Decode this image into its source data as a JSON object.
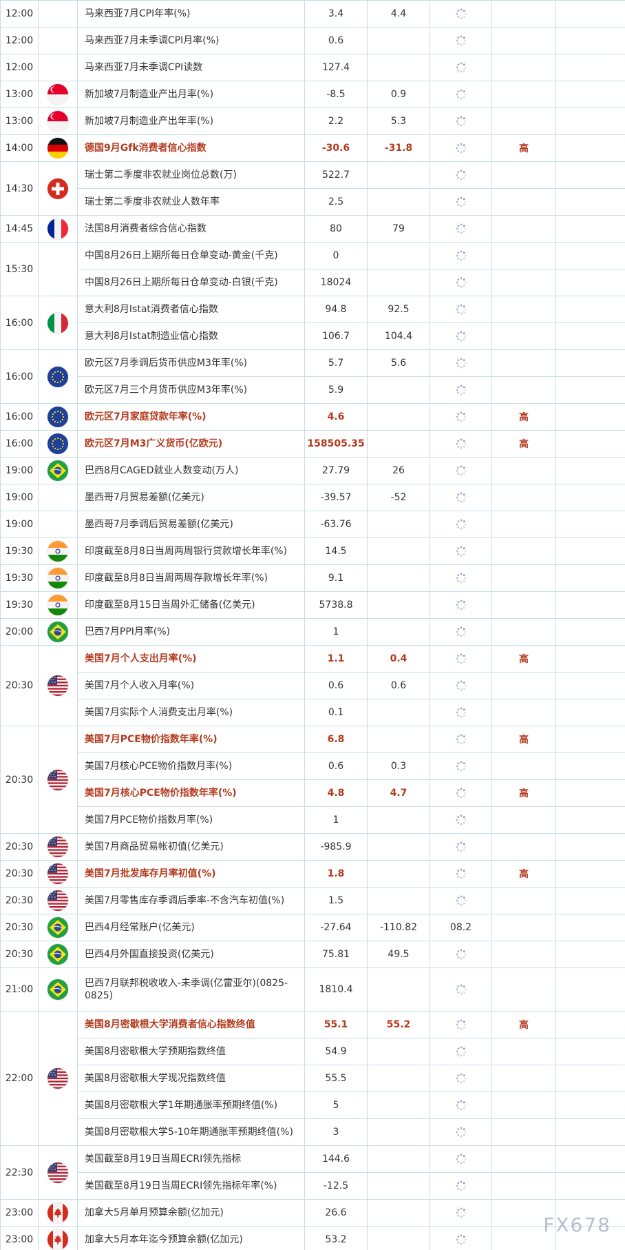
{
  "watermark": "FX678",
  "colors": {
    "border": "#c8dcea",
    "highlight": "#b33a1e",
    "text": "#333333"
  },
  "rows": [
    {
      "time": "12:00",
      "flag": "malaysia",
      "event": "马来西亚7月CPI年率(%)",
      "actual": "3.4",
      "forecast": "4.4",
      "importance": "",
      "hi": false
    },
    {
      "time": "12:00",
      "flag": "malaysia",
      "event": "马来西亚7月未季调CPI月率(%)",
      "actual": "0.6",
      "forecast": "",
      "importance": "",
      "hi": false
    },
    {
      "time": "12:00",
      "flag": "malaysia",
      "event": "马来西亚7月未季调CPI读数",
      "actual": "127.4",
      "forecast": "",
      "importance": "",
      "hi": false
    },
    {
      "time": "13:00",
      "flag": "singapore",
      "event": "新加坡7月制造业产出月率(%)",
      "actual": "-8.5",
      "forecast": "0.9",
      "importance": "",
      "hi": false
    },
    {
      "time": "13:00",
      "flag": "singapore",
      "event": "新加坡7月制造业产出年率(%)",
      "actual": "2.2",
      "forecast": "5.3",
      "importance": "",
      "hi": false
    },
    {
      "time": "14:00",
      "flag": "germany",
      "event": "德国9月Gfk消费者信心指数",
      "actual": "-30.6",
      "forecast": "-31.8",
      "importance": "高",
      "hi": true
    },
    {
      "time": "14:30",
      "flag": "switzerland",
      "event": "瑞士第二季度非农就业岗位总数(万)",
      "actual": "522.7",
      "forecast": "",
      "importance": "",
      "hi": false,
      "span": 2
    },
    {
      "time": "",
      "flag": "",
      "event": "瑞士第二季度非农就业人数年率",
      "actual": "2.5",
      "forecast": "",
      "importance": "",
      "hi": false,
      "cont": true
    },
    {
      "time": "14:45",
      "flag": "france",
      "event": "法国8月消费者综合信心指数",
      "actual": "80",
      "forecast": "79",
      "importance": "",
      "hi": false
    },
    {
      "time": "15:30",
      "flag": "china",
      "event": "中国8月26日上期所每日仓单变动-黄金(千克)",
      "actual": "0",
      "forecast": "",
      "importance": "",
      "hi": false,
      "span": 2
    },
    {
      "time": "",
      "flag": "",
      "event": "中国8月26日上期所每日仓单变动-白银(千克)",
      "actual": "18024",
      "forecast": "",
      "importance": "",
      "hi": false,
      "cont": true
    },
    {
      "time": "16:00",
      "flag": "italy",
      "event": "意大利8月Istat消费者信心指数",
      "actual": "94.8",
      "forecast": "92.5",
      "importance": "",
      "hi": false,
      "span": 2
    },
    {
      "time": "",
      "flag": "",
      "event": "意大利8月Istat制造业信心指数",
      "actual": "106.7",
      "forecast": "104.4",
      "importance": "",
      "hi": false,
      "cont": true
    },
    {
      "time": "16:00",
      "flag": "eu",
      "event": "欧元区7月季调后货币供应M3年率(%)",
      "actual": "5.7",
      "forecast": "5.6",
      "importance": "",
      "hi": false,
      "span": 2
    },
    {
      "time": "",
      "flag": "",
      "event": "欧元区7月三个月货币供应M3年率(%)",
      "actual": "5.9",
      "forecast": "",
      "importance": "",
      "hi": false,
      "cont": true
    },
    {
      "time": "16:00",
      "flag": "eu",
      "event": "欧元区7月家庭贷款年率(%)",
      "actual": "4.6",
      "forecast": "",
      "importance": "高",
      "hi": true
    },
    {
      "time": "16:00",
      "flag": "eu",
      "event": "欧元区7月M3广义货币(亿欧元)",
      "actual": "158505.35",
      "forecast": "",
      "importance": "高",
      "hi": true
    },
    {
      "time": "19:00",
      "flag": "brazil",
      "event": "巴西8月CAGED就业人数变动(万人)",
      "actual": "27.79",
      "forecast": "26",
      "importance": "",
      "hi": false
    },
    {
      "time": "19:00",
      "flag": "mexico",
      "event": "墨西哥7月贸易差额(亿美元)",
      "actual": "-39.57",
      "forecast": "-52",
      "importance": "",
      "hi": false
    },
    {
      "time": "19:00",
      "flag": "mexico",
      "event": "墨西哥7月季调后贸易差额(亿美元)",
      "actual": "-63.76",
      "forecast": "",
      "importance": "",
      "hi": false
    },
    {
      "time": "19:30",
      "flag": "india",
      "event": "印度截至8月8日当周两周银行贷款增长年率(%)",
      "actual": "14.5",
      "forecast": "",
      "importance": "",
      "hi": false
    },
    {
      "time": "19:30",
      "flag": "india",
      "event": "印度截至8月8日当周两周存款增长年率(%)",
      "actual": "9.1",
      "forecast": "",
      "importance": "",
      "hi": false
    },
    {
      "time": "19:30",
      "flag": "india",
      "event": "印度截至8月15日当周外汇储备(亿美元)",
      "actual": "5738.8",
      "forecast": "",
      "importance": "",
      "hi": false
    },
    {
      "time": "20:00",
      "flag": "brazil",
      "event": "巴西7月PPI月率(%)",
      "actual": "1",
      "forecast": "",
      "importance": "",
      "hi": false
    },
    {
      "time": "20:30",
      "flag": "usa",
      "event": "美国7月个人支出月率(%)",
      "actual": "1.1",
      "forecast": "0.4",
      "importance": "高",
      "hi": true,
      "span": 3
    },
    {
      "time": "",
      "flag": "",
      "event": "美国7月个人收入月率(%)",
      "actual": "0.6",
      "forecast": "0.6",
      "importance": "",
      "hi": false,
      "cont": true
    },
    {
      "time": "",
      "flag": "",
      "event": "美国7月实际个人消费支出月率(%)",
      "actual": "0.1",
      "forecast": "",
      "importance": "",
      "hi": false,
      "cont": true
    },
    {
      "time": "20:30",
      "flag": "usa",
      "event": "美国7月PCE物价指数年率(%)",
      "actual": "6.8",
      "forecast": "",
      "importance": "高",
      "hi": true,
      "span": 4
    },
    {
      "time": "",
      "flag": "",
      "event": "美国7月核心PCE物价指数月率(%)",
      "actual": "0.6",
      "forecast": "0.3",
      "importance": "",
      "hi": false,
      "cont": true
    },
    {
      "time": "",
      "flag": "",
      "event": "美国7月核心PCE物价指数年率(%)",
      "actual": "4.8",
      "forecast": "4.7",
      "importance": "高",
      "hi": true,
      "cont": true
    },
    {
      "time": "",
      "flag": "",
      "event": "美国7月PCE物价指数月率(%)",
      "actual": "1",
      "forecast": "",
      "importance": "",
      "hi": false,
      "cont": true
    },
    {
      "time": "20:30",
      "flag": "usa",
      "event": "美国7月商品贸易帐初值(亿美元)",
      "actual": "-985.9",
      "forecast": "",
      "importance": "",
      "hi": false
    },
    {
      "time": "20:30",
      "flag": "usa",
      "event": "美国7月批发库存月率初值(%)",
      "actual": "1.8",
      "forecast": "",
      "importance": "高",
      "hi": true
    },
    {
      "time": "20:30",
      "flag": "usa",
      "event": "美国7月零售库存季调后季率-不含汽车初值(%)",
      "actual": "1.5",
      "forecast": "",
      "importance": "",
      "hi": false
    },
    {
      "time": "20:30",
      "flag": "brazil",
      "event": "巴西4月经常账户(亿美元)",
      "actual": "-27.64",
      "forecast": "-110.82",
      "extra": "08.2",
      "importance": "",
      "hi": false
    },
    {
      "time": "20:30",
      "flag": "brazil",
      "event": "巴西4月外国直接投资(亿美元)",
      "actual": "75.81",
      "forecast": "49.5",
      "importance": "",
      "hi": false
    },
    {
      "time": "21:00",
      "flag": "brazil",
      "event": "巴西7月联邦税收收入-未季调(亿雷亚尔)(0825-0825)",
      "actual": "1810.4",
      "forecast": "",
      "importance": "",
      "hi": false,
      "tall": true
    },
    {
      "time": "22:00",
      "flag": "usa",
      "event": "美国8月密歇根大学消费者信心指数终值",
      "actual": "55.1",
      "forecast": "55.2",
      "importance": "高",
      "hi": true,
      "span": 5
    },
    {
      "time": "",
      "flag": "",
      "event": "美国8月密歇根大学预期指数终值",
      "actual": "54.9",
      "forecast": "",
      "importance": "",
      "hi": false,
      "cont": true
    },
    {
      "time": "",
      "flag": "",
      "event": "美国8月密歇根大学现况指数终值",
      "actual": "55.5",
      "forecast": "",
      "importance": "",
      "hi": false,
      "cont": true
    },
    {
      "time": "",
      "flag": "",
      "event": "美国8月密歇根大学1年期通胀率预期终值(%)",
      "actual": "5",
      "forecast": "",
      "importance": "",
      "hi": false,
      "cont": true
    },
    {
      "time": "",
      "flag": "",
      "event": "美国8月密歇根大学5-10年期通胀率预期终值(%)",
      "actual": "3",
      "forecast": "",
      "importance": "",
      "hi": false,
      "cont": true
    },
    {
      "time": "22:30",
      "flag": "usa",
      "event": "美国截至8月19日当周ECRI领先指标",
      "actual": "144.6",
      "forecast": "",
      "importance": "",
      "hi": false,
      "span": 2
    },
    {
      "time": "",
      "flag": "",
      "event": "美国截至8月19日当周ECRI领先指标年率(%)",
      "actual": "-12.5",
      "forecast": "",
      "importance": "",
      "hi": false,
      "cont": true
    },
    {
      "time": "23:00",
      "flag": "canada",
      "event": "加拿大5月单月预算余额(亿加元)",
      "actual": "26.6",
      "forecast": "",
      "importance": "",
      "hi": false
    },
    {
      "time": "23:00",
      "flag": "canada",
      "event": "加拿大5月本年迄今预算余额(亿加元)",
      "actual": "53.2",
      "forecast": "",
      "importance": "",
      "hi": false
    }
  ]
}
